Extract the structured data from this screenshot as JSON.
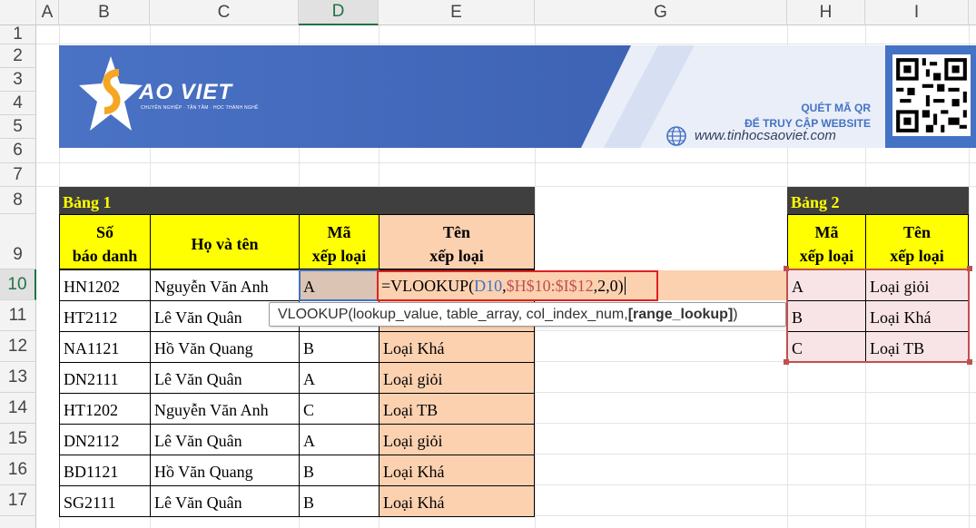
{
  "columns": [
    "A",
    "B",
    "C",
    "D",
    "E",
    "G",
    "H",
    "I"
  ],
  "rows": [
    "1",
    "2",
    "3",
    "4",
    "5",
    "6",
    "7",
    "8",
    "9",
    "10",
    "11",
    "12",
    "13",
    "14",
    "15",
    "16",
    "17"
  ],
  "banner": {
    "logo_text": "AO VIET",
    "logo_tagline": "CHUYÊN NGHIỆP · TẬN TÂM · HỌC THÀNH NGHỀ",
    "qr_line1": "QUÉT MÃ QR",
    "qr_line2": "ĐỂ TRUY CẬP WEBSITE",
    "website": "www.tinhocsaoviet.com",
    "colors": {
      "blue": "#4472c4",
      "light": "#e9eef8",
      "accent": "#f5a623"
    }
  },
  "table1": {
    "title": "Bảng 1",
    "headers": {
      "sbd_1": "Số",
      "sbd_2": "báo danh",
      "name": "Họ và tên",
      "ma_1": "Mã",
      "ma_2": "xếp loại",
      "ten_1": "Tên",
      "ten_2": "xếp loại"
    },
    "rows": [
      {
        "sbd": "HN1202",
        "name": "Nguyễn Văn Anh",
        "ma": "A",
        "ten": ""
      },
      {
        "sbd": "HT2112",
        "name": "Lê Văn Quân",
        "ma": "",
        "ten": ""
      },
      {
        "sbd": "NA1121",
        "name": "Hồ Văn Quang",
        "ma": "B",
        "ten": "Loại Khá"
      },
      {
        "sbd": "DN2111",
        "name": "Lê Văn Quân",
        "ma": "A",
        "ten": "Loại giỏi"
      },
      {
        "sbd": "HT1202",
        "name": "Nguyễn Văn Anh",
        "ma": "C",
        "ten": "Loại TB"
      },
      {
        "sbd": "DN2112",
        "name": "Lê Văn Quân",
        "ma": "A",
        "ten": "Loại giỏi"
      },
      {
        "sbd": "BD1121",
        "name": "Hồ Văn Quang",
        "ma": "B",
        "ten": "Loại Khá"
      },
      {
        "sbd": "SG2111",
        "name": "Lê Văn Quân",
        "ma": "B",
        "ten": "Loại Khá"
      }
    ]
  },
  "table2": {
    "title": "Bảng 2",
    "headers": {
      "ma_1": "Mã",
      "ma_2": "xếp loại",
      "ten_1": "Tên",
      "ten_2": "xếp loại"
    },
    "rows": [
      {
        "ma": "A",
        "ten": "Loại giỏi"
      },
      {
        "ma": "B",
        "ten": "Loại Khá"
      },
      {
        "ma": "C",
        "ten": "Loại TB"
      }
    ]
  },
  "formula": {
    "prefix": "=VLOOKUP(",
    "ref1": "D10",
    "sep1": ",",
    "ref2": "$H$10:$I$12",
    "rest": ",2,0)",
    "ref1_color": "#4472c4",
    "ref2_color": "#c0504d"
  },
  "tooltip": {
    "fn": "VLOOKUP(",
    "args": "lookup_value, table_array, col_index_num, ",
    "optional": "[range_lookup]",
    "close": ")"
  }
}
